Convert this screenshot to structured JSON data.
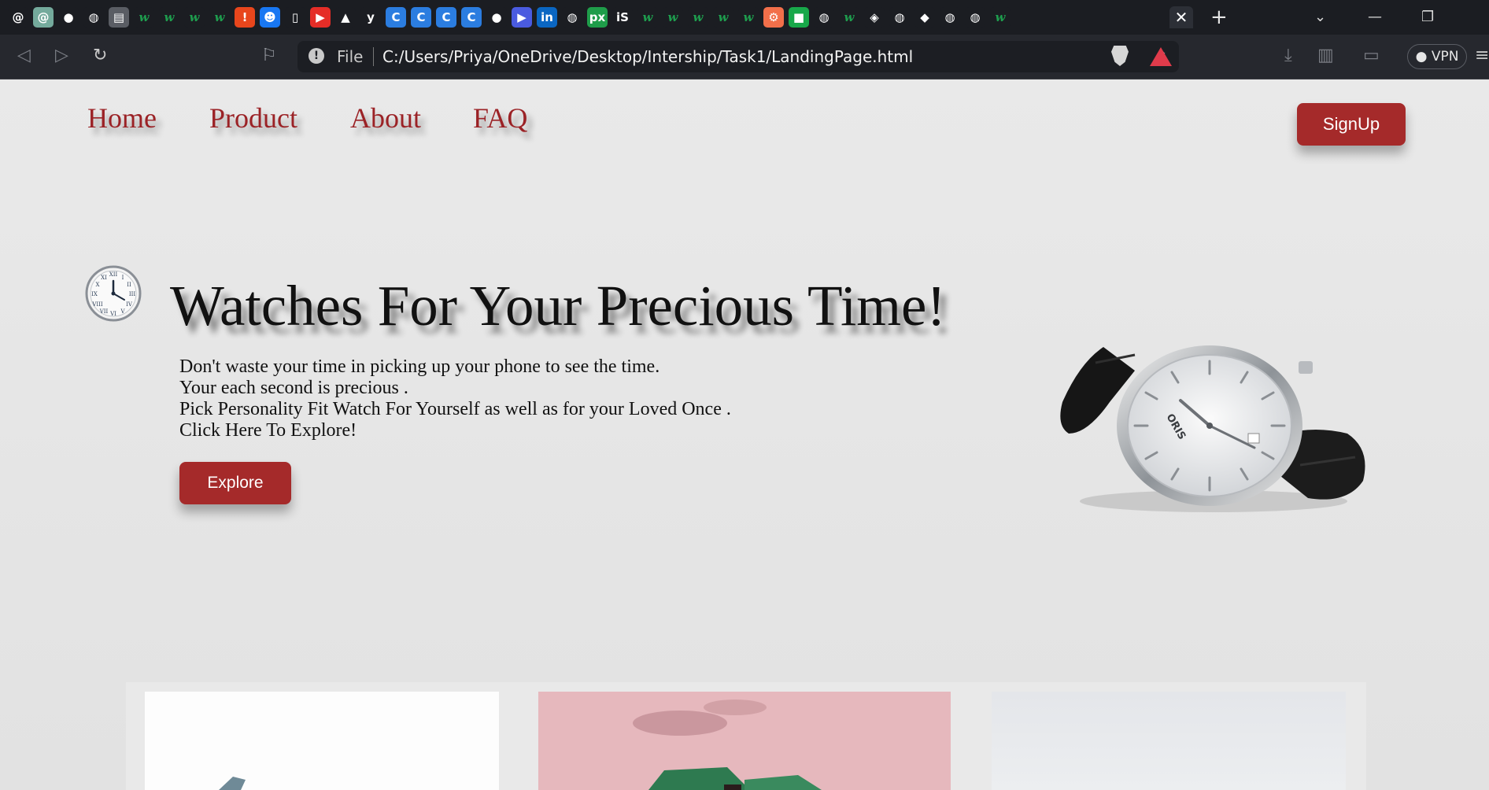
{
  "browser": {
    "tab_icons": [
      {
        "icon": "openai-icon",
        "glyph": "@",
        "bg": "#1b1d22"
      },
      {
        "icon": "chatgpt-icon",
        "glyph": "@",
        "bg": "#74aa9c"
      },
      {
        "icon": "github-icon",
        "glyph": "●",
        "bg": "#1b1d22"
      },
      {
        "icon": "globe-icon",
        "glyph": "◍",
        "bg": "#1b1d22"
      },
      {
        "icon": "page-icon",
        "glyph": "▤",
        "bg": "#5a5d64"
      },
      {
        "icon": "w3schools-icon",
        "glyph": "w",
        "bg": "#1b1d22"
      },
      {
        "icon": "w3schools-icon",
        "glyph": "w",
        "bg": "#1b1d22"
      },
      {
        "icon": "w3schools-icon",
        "glyph": "w",
        "bg": "#1b1d22"
      },
      {
        "icon": "w3schools-icon",
        "glyph": "w",
        "bg": "#1b1d22"
      },
      {
        "icon": "alert-icon",
        "glyph": "!",
        "bg": "#e8461c"
      },
      {
        "icon": "messenger-icon",
        "glyph": "☻",
        "bg": "#1877f2"
      },
      {
        "icon": "docs-icon",
        "glyph": "▯",
        "bg": "#1b1d22"
      },
      {
        "icon": "youtube-icon",
        "glyph": "▶",
        "bg": "#e52d27"
      },
      {
        "icon": "drive-icon",
        "glyph": "▲",
        "bg": "#1b1d22"
      },
      {
        "icon": "yahoo-icon",
        "glyph": "y",
        "bg": "#1b1d22"
      },
      {
        "icon": "canva-icon",
        "glyph": "C",
        "bg": "#2b7de0"
      },
      {
        "icon": "canva-icon",
        "glyph": "C",
        "bg": "#2b7de0"
      },
      {
        "icon": "canva-icon",
        "glyph": "C",
        "bg": "#2b7de0"
      },
      {
        "icon": "canva-icon",
        "glyph": "C",
        "bg": "#2b7de0"
      },
      {
        "icon": "github-icon",
        "glyph": "●",
        "bg": "#1b1d22"
      },
      {
        "icon": "video-icon",
        "glyph": "▶",
        "bg": "#4a5be0"
      },
      {
        "icon": "linkedin-icon",
        "glyph": "in",
        "bg": "#0a66c2"
      },
      {
        "icon": "globe-icon",
        "glyph": "◍",
        "bg": "#1b1d22"
      },
      {
        "icon": "px-icon",
        "glyph": "px",
        "bg": "#1f9d4a"
      },
      {
        "icon": "is-icon",
        "glyph": "iS",
        "bg": "#1b1d22"
      },
      {
        "icon": "w3schools-icon",
        "glyph": "w",
        "bg": "#1b1d22"
      },
      {
        "icon": "w3schools-icon",
        "glyph": "w",
        "bg": "#1b1d22"
      },
      {
        "icon": "w3schools-icon",
        "glyph": "w",
        "bg": "#1b1d22"
      },
      {
        "icon": "w3schools-icon",
        "glyph": "w",
        "bg": "#1b1d22"
      },
      {
        "icon": "w3schools-icon",
        "glyph": "w",
        "bg": "#1b1d22"
      },
      {
        "icon": "hubspot-icon",
        "glyph": "⚙",
        "bg": "#f26f4a"
      },
      {
        "icon": "green-app-icon",
        "glyph": "■",
        "bg": "#18a84a"
      },
      {
        "icon": "globe-icon",
        "glyph": "◍",
        "bg": "#1b1d22"
      },
      {
        "icon": "w3schools-icon",
        "glyph": "w",
        "bg": "#1b1d22"
      },
      {
        "icon": "layers-icon",
        "glyph": "◈",
        "bg": "#1b1d22"
      },
      {
        "icon": "globe-icon",
        "glyph": "◍",
        "bg": "#1b1d22"
      },
      {
        "icon": "diamond-icon",
        "glyph": "◆",
        "bg": "#1b1d22"
      },
      {
        "icon": "globe-icon",
        "glyph": "◍",
        "bg": "#1b1d22"
      },
      {
        "icon": "globe-icon",
        "glyph": "◍",
        "bg": "#1b1d22"
      },
      {
        "icon": "w3schools-icon",
        "glyph": "w",
        "bg": "#1b1d22"
      }
    ],
    "tab_close": "✕",
    "new_tab": "+",
    "address": {
      "scheme": "File",
      "url": "C:/Users/Priya/OneDrive/Desktop/Intership/Task1/LandingPage.html"
    },
    "vpn_label": "● VPN",
    "colors": {
      "chrome_bg": "#1b1d22",
      "toolbar_bg": "#26282e",
      "brave_red": "#e03b4b"
    }
  },
  "nav": {
    "links": [
      "Home",
      "Product",
      "About",
      "FAQ"
    ],
    "signup_label": "SignUp"
  },
  "hero": {
    "title": "Watches For Your Precious Time!",
    "lines": [
      "Don't waste your time in picking up your phone to see the time.",
      "Your each second is precious .",
      "Pick Personality Fit Watch For Yourself as well as for your Loved Once .",
      "Click Here To Explore!"
    ],
    "button_label": "Explore",
    "watch_brand": "ORIS"
  },
  "theme": {
    "accent": "#a52a2a",
    "link": "#9b2226",
    "text": "#111111",
    "page_bg": "#e6e6e6"
  }
}
